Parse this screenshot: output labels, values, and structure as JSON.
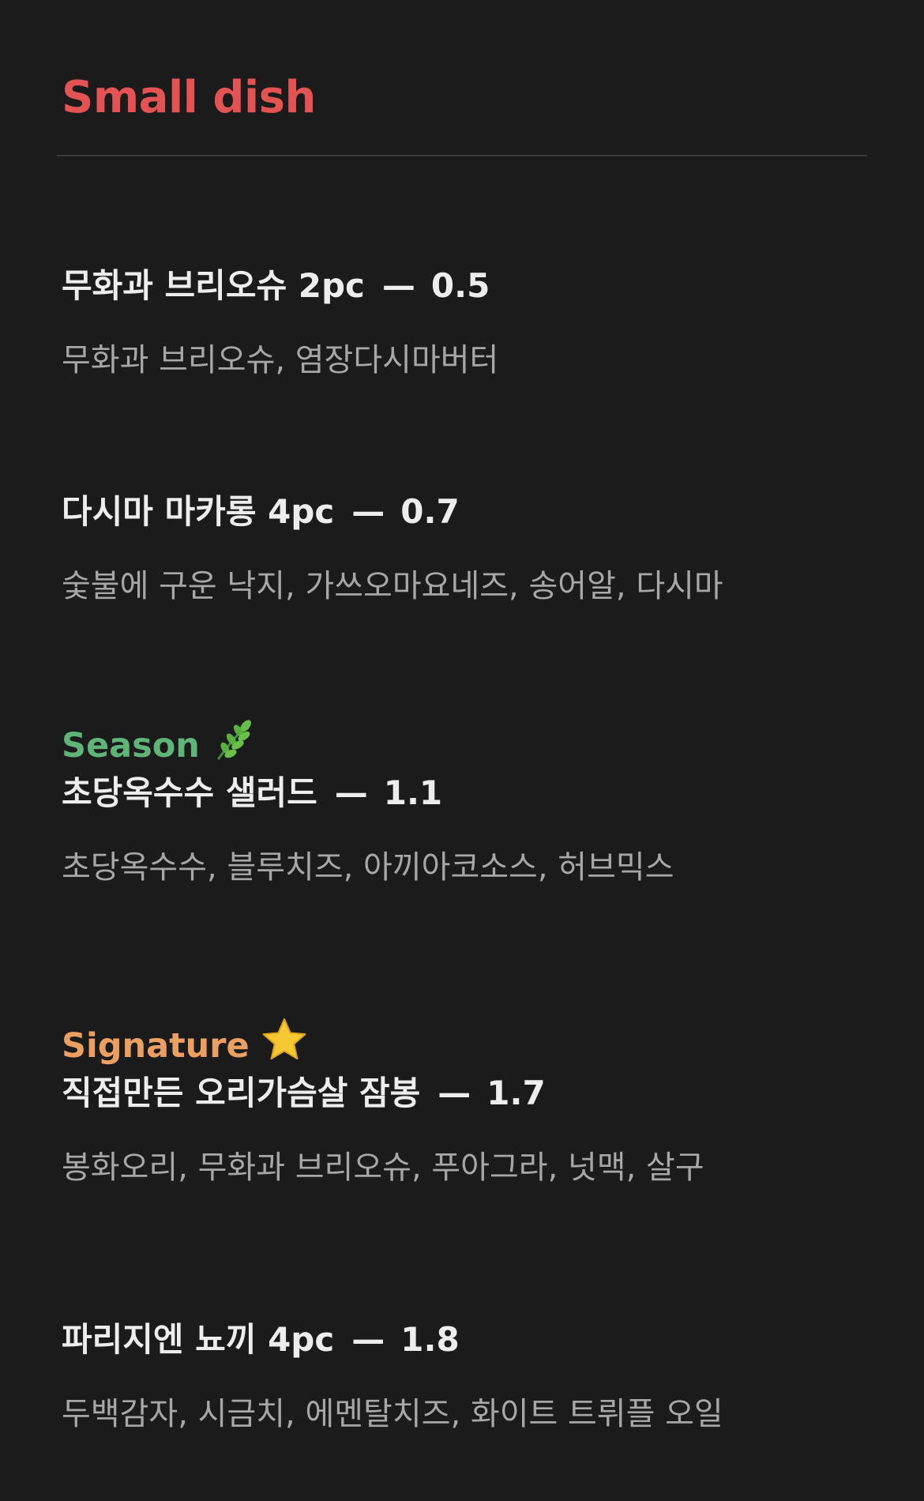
{
  "section": {
    "title": "Small dish"
  },
  "colors": {
    "background": "#1b1b1c",
    "section_title": "#e35353",
    "season_label": "#5fb577",
    "signature_label": "#eba062",
    "item_title": "#ededed",
    "item_desc": "#a7a7a7",
    "divider": "#3a3a3c"
  },
  "items": [
    {
      "name": "무화과 브리오슈 2pc",
      "dash": "—",
      "price": "0.5",
      "description": "무화과 브리오슈, 염장다시마버터"
    },
    {
      "name": "다시마 마카롱 4pc",
      "dash": "—",
      "price": "0.7",
      "description": "숯불에 구운 낙지, 가쓰오마요네즈, 송어알, 다시마"
    },
    {
      "label": "Season",
      "label_icon": "herb-icon",
      "name": "초당옥수수 샐러드",
      "dash": "—",
      "price": "1.1",
      "description": "초당옥수수, 블루치즈, 아끼아코소스, 허브믹스"
    },
    {
      "label": "Signature",
      "label_icon": "star-icon",
      "name": "직접만든 오리가슴살 잠봉",
      "dash": "—",
      "price": "1.7",
      "description": "봉화오리, 무화과 브리오슈, 푸아그라, 넛맥, 살구"
    },
    {
      "name": "파리지엔 뇨끼 4pc",
      "dash": "—",
      "price": "1.8",
      "description": "두백감자, 시금치, 에멘탈치즈, 화이트 트뤼플 오일"
    }
  ]
}
